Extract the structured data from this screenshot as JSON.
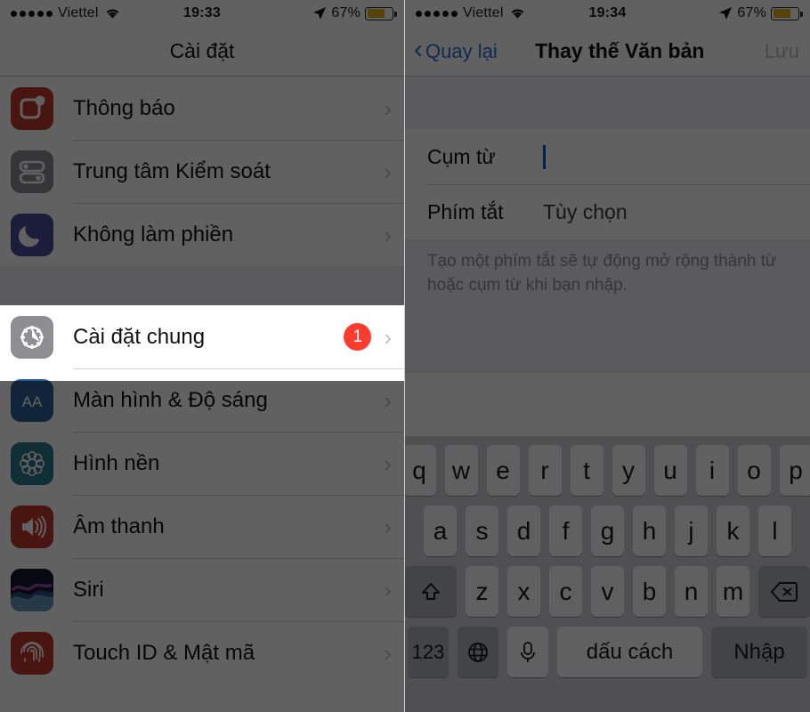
{
  "left": {
    "status": {
      "signal_dots": 5,
      "carrier": "Viettel",
      "wifi_icon": "wifi-icon",
      "time": "19:33",
      "location_icon": "location-arrow-icon",
      "battery_pct": "67%",
      "battery_color": "#e0b418"
    },
    "nav": {
      "title": "Cài đặt"
    },
    "groups": [
      {
        "items": [
          {
            "label": "Thông báo",
            "icon": "notifications-icon",
            "icon_bg": "#c0392b",
            "chevron": "›"
          },
          {
            "label": "Trung tâm Kiểm soát",
            "icon": "control-center-icon",
            "icon_bg": "#8e8e93",
            "chevron": "›"
          },
          {
            "label": "Không làm phiền",
            "icon": "do-not-disturb-icon",
            "icon_bg": "#4a4a9c",
            "chevron": "›"
          }
        ]
      },
      {
        "items": [
          {
            "label": "Cài đặt chung",
            "icon": "general-gear-icon",
            "icon_bg": "#8e8e93",
            "badge": "1",
            "chevron": "›",
            "highlighted": true
          },
          {
            "label": "Màn hình & Độ sáng",
            "icon": "display-brightness-icon",
            "icon_bg": "#2a6099",
            "chevron": "›"
          },
          {
            "label": "Hình nền",
            "icon": "wallpaper-icon",
            "icon_bg": "#2b7a8c",
            "chevron": "›"
          },
          {
            "label": "Âm thanh",
            "icon": "sounds-icon",
            "icon_bg": "#c0392b",
            "chevron": "›"
          },
          {
            "label": "Siri",
            "icon": "siri-icon",
            "icon_bg": "#1c1c2e",
            "chevron": "›"
          },
          {
            "label": "Touch ID & Mật mã",
            "icon": "touch-id-icon",
            "icon_bg": "#c0392b",
            "chevron": "›"
          }
        ]
      }
    ]
  },
  "right": {
    "status": {
      "signal_dots": 5,
      "carrier": "Viettel",
      "wifi_icon": "wifi-icon",
      "time": "19:34",
      "location_icon": "location-arrow-icon",
      "battery_pct": "67%",
      "battery_color": "#e0b418"
    },
    "nav": {
      "back_label": "Quay lại",
      "back_icon": "chevron-left-icon",
      "title": "Thay thế Văn bản",
      "save_label": "Lưu"
    },
    "form": {
      "fields": [
        {
          "label": "Cụm từ",
          "value": "",
          "has_caret": true
        },
        {
          "label": "Phím tắt",
          "value": "Tùy chọn",
          "has_caret": false
        }
      ],
      "help_text": "Tạo một phím tắt sẽ tự động mở rộng thành từ hoặc cụm từ khi bạn nhập."
    },
    "keyboard": {
      "row1": [
        "q",
        "w",
        "e",
        "r",
        "t",
        "y",
        "u",
        "i",
        "o",
        "p"
      ],
      "row2": [
        "a",
        "s",
        "d",
        "f",
        "g",
        "h",
        "j",
        "k",
        "l"
      ],
      "row3": [
        "z",
        "x",
        "c",
        "v",
        "b",
        "n",
        "m"
      ],
      "shift_icon": "shift-up-arrow-icon",
      "backspace_icon": "backspace-delete-icon",
      "numeric_label": "123",
      "globe_icon": "globe-language-icon",
      "mic_icon": "microphone-icon",
      "space_label": "dấu cách",
      "return_label": "Nhập"
    }
  }
}
